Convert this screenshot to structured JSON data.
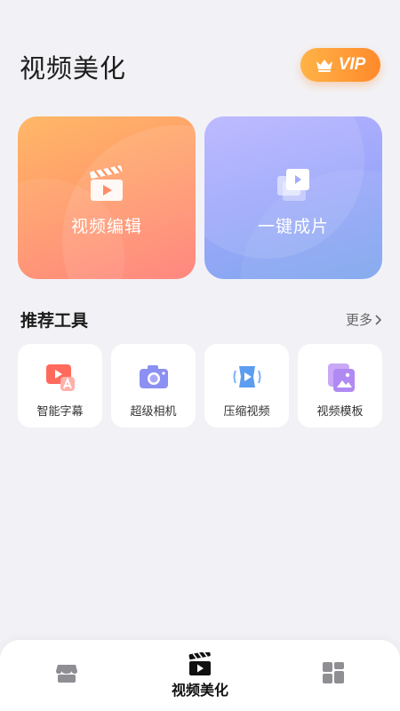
{
  "header": {
    "title": "视频美化",
    "vip_label": "VIP"
  },
  "feature_cards": [
    {
      "label": "视频编辑",
      "icon": "clapperboard-play-icon"
    },
    {
      "label": "一键成片",
      "icon": "stacked-video-icon"
    }
  ],
  "tools_section": {
    "title": "推荐工具",
    "more_label": "更多",
    "items": [
      {
        "label": "智能字幕",
        "icon": "smart-subtitle-icon"
      },
      {
        "label": "超级相机",
        "icon": "camera-icon"
      },
      {
        "label": "压缩视频",
        "icon": "compress-video-icon"
      },
      {
        "label": "视频模板",
        "icon": "video-template-icon"
      }
    ]
  },
  "tabbar": {
    "items": [
      {
        "label": "",
        "icon": "store-icon"
      },
      {
        "label": "视频美化",
        "icon": "clapperboard-icon",
        "active": true
      },
      {
        "label": "",
        "icon": "grid-apps-icon"
      }
    ]
  },
  "colors": {
    "vip_gradient": [
      "#ffb347",
      "#ff8a2b"
    ],
    "card_edit_gradient": [
      "#ffb868",
      "#ff7a72"
    ],
    "card_one_gradient": [
      "#b7b2ff",
      "#80a7ee"
    ],
    "background": "#f2f2f6"
  }
}
